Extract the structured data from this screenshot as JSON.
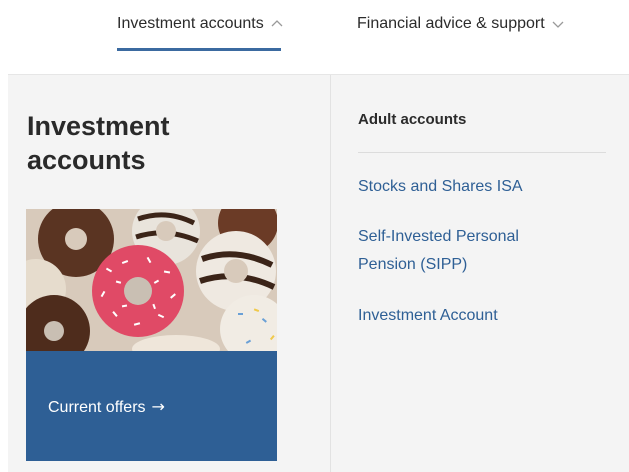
{
  "nav": {
    "items": [
      {
        "label": "Investment accounts",
        "icon": "chevron-up-icon",
        "active": true
      },
      {
        "label": "Financial advice & support",
        "icon": "chevron-down-icon",
        "active": false
      }
    ]
  },
  "panel": {
    "title": "Investment accounts",
    "promo": {
      "label": "Current offers",
      "arrow": "→",
      "color": "#2e5f95"
    },
    "section": {
      "heading": "Adult accounts",
      "links": [
        {
          "label": "Stocks and Shares ISA"
        },
        {
          "label": "Self-Invested Personal Pension (SIPP)"
        },
        {
          "label": "Investment Account"
        }
      ]
    }
  },
  "colors": {
    "accent": "#3b6aa0",
    "link": "#2e5f95",
    "panel_bg": "#f4f4f4"
  }
}
